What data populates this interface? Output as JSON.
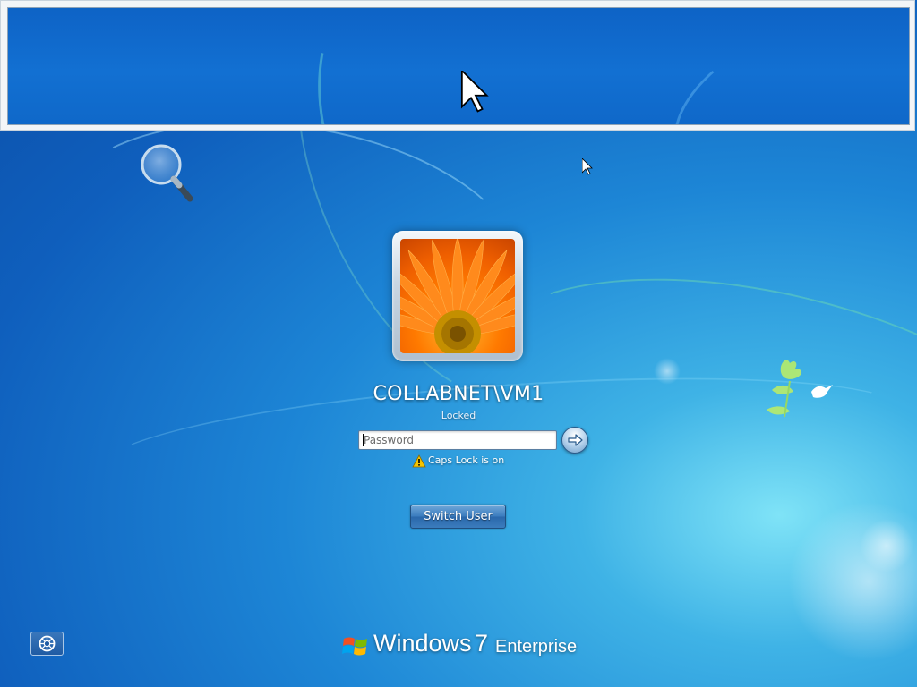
{
  "screen": {
    "type": "windows-7-lock-screen"
  },
  "magnifier": {
    "mode": "docked"
  },
  "user": {
    "name": "COLLABNET\\VM1",
    "status": "Locked",
    "picture": "orange-gerbera-flower"
  },
  "password": {
    "placeholder": "Password",
    "value": ""
  },
  "warning": {
    "icon": "warning-icon",
    "text": "Caps Lock is on"
  },
  "buttons": {
    "submit_icon": "arrow-right-icon",
    "switch_user": "Switch User",
    "ease_of_access_icon": "ease-of-access-icon"
  },
  "branding": {
    "brand": "Windows",
    "version": "7",
    "edition": "Enterprise"
  },
  "colors": {
    "background": "#1d86d6",
    "accent": "#3c7dbf",
    "warning": "#f5c400"
  }
}
